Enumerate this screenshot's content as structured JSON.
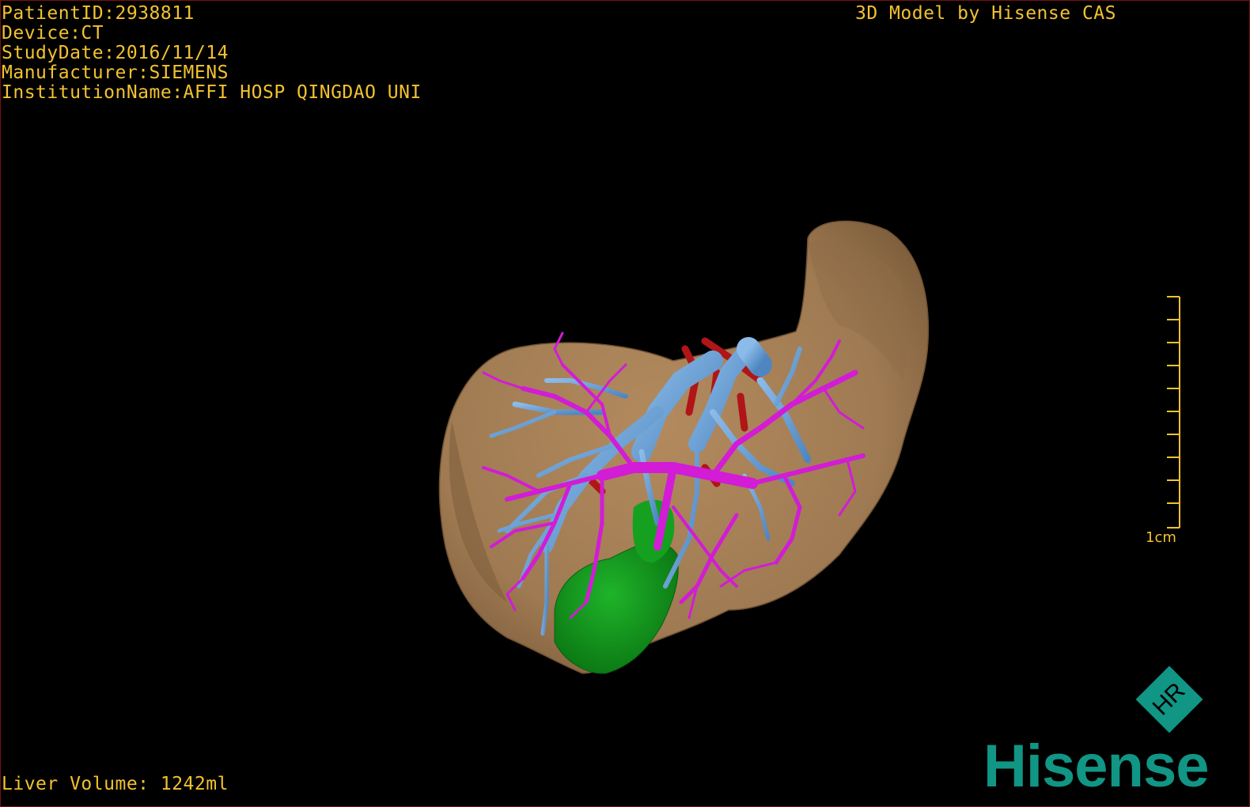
{
  "header": {
    "patient_id": "PatientID:2938811",
    "device": "Device:CT",
    "study_date": "StudyDate:2016/11/14",
    "manufacturer": "Manufacturer:SIEMENS",
    "institution": "InstitutionName:AFFI HOSP QINGDAO UNI"
  },
  "credit": "3D Model by Hisense CAS",
  "footer": {
    "liver_volume": "Liver Volume: 1242ml"
  },
  "scale": {
    "label": "1cm",
    "ticks": 10
  },
  "logo": {
    "wordmark": "Hisense",
    "badge_text": "HR"
  },
  "colors": {
    "overlay_text": "#f2c230",
    "liver": "#a67e55",
    "portal_vein": "#d21cd6",
    "hepatic_vein": "#6fa6dc",
    "artery": "#b01518",
    "tumor": "#129a1e",
    "brand": "#119585"
  },
  "structures": [
    "liver-surface",
    "hepatic-vein",
    "portal-vein",
    "hepatic-artery",
    "lesion"
  ]
}
